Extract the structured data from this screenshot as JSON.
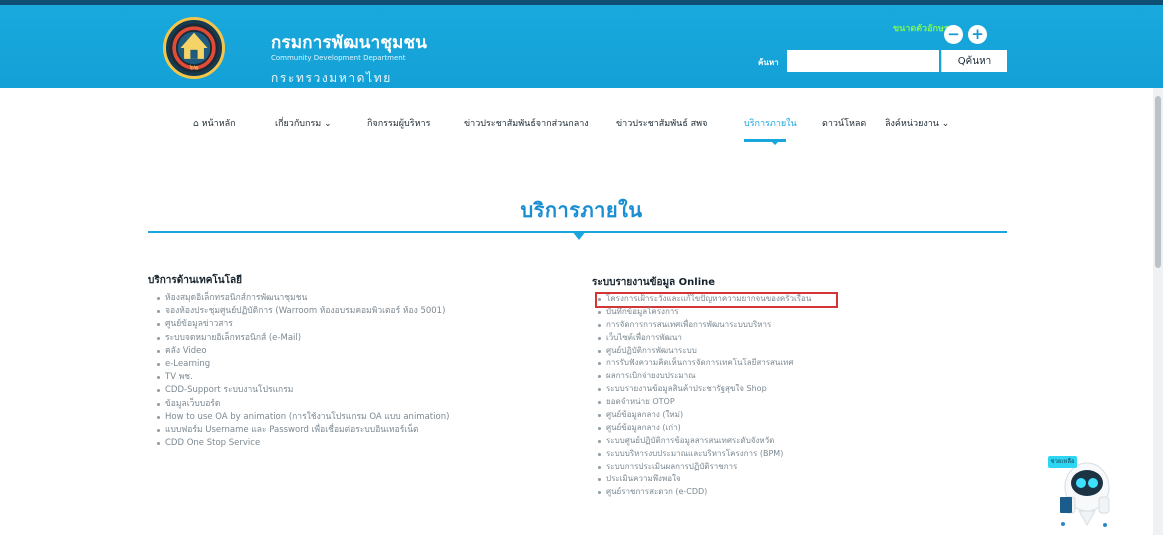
{
  "header": {
    "dept_name": "กรมการพัฒนาชุมชน",
    "dept_english": "Community Development Department",
    "ministry": "กระทรวงมหาดไทย",
    "logo_year": "๖๒",
    "font_size_label": "ขนาดตัวอักษร",
    "minus": "−",
    "plus": "+",
    "search_label": "ค้นหา",
    "search_placeholder": "",
    "search_button": "Qค้นหา",
    "brand_color": "#13a0d6"
  },
  "nav": {
    "items": [
      {
        "label": "หน้าหลัก",
        "icon": "home-icon"
      },
      {
        "label": "เกี่ยวกับกรม ⌄"
      },
      {
        "label": "กิจกรรมผู้บริหาร"
      },
      {
        "label": "ข่าวประชาสัมพันธ์จากส่วนกลาง"
      },
      {
        "label": "ข่าวประชาสัมพันธ์ สพจ"
      },
      {
        "label": "บริการภายใน",
        "active": true
      },
      {
        "label": "ดาวน์โหลด"
      },
      {
        "label": "ลิงค์หน่วยงาน ⌄"
      }
    ]
  },
  "page": {
    "title": "บริการภายใน"
  },
  "left_section": {
    "heading": "บริการด้านเทคโนโลยี",
    "items": [
      "ห้องสมุดอิเล็กทรอนิกส์การพัฒนาชุมชน",
      "จองห้องประชุมศูนย์ปฏิบัติการ (Warroom ห้องอบรมคอมพิวเตอร์ ห้อง 5001)",
      "ศูนย์ข้อมูลข่าวสาร",
      "ระบบจดหมายอิเล็กทรอนิกส์ (e-Mail)",
      "คลัง Video",
      "e-Learning",
      "TV พช.",
      "CDD-Support ระบบงานโปรแกรม",
      "ข้อมูลเว็บบอร์ด",
      "How to use OA by animation (การใช้งานโปรแกรม OA แบบ animation)",
      "แบบฟอร์ม Username และ Password เพื่อเชื่อมต่อระบบอินเทอร์เน็ต",
      "CDD One Stop Service"
    ]
  },
  "right_section": {
    "heading": "ระบบรายงานข้อมูล Online",
    "highlight_color": "#d53437",
    "items": [
      "โครงการเฝ้าระวังและแก้ไขปัญหาความยากจนของครัวเรือน",
      "บันทึกข้อมูลโครงการ",
      "การจัดการการสนเทศเพื่อการพัฒนาระบบบริหาร",
      "เว็บไซต์เพื่อการพัฒนา",
      "ศูนย์ปฏิบัติการพัฒนาระบบ",
      "การรับฟังความคิดเห็นการจัดการเทคโนโลยีสารสนเทศ",
      "ผลการเบิกจ่ายงบประมาณ",
      "ระบบรายงานข้อมูลสินค้าประชารัฐสุขใจ Shop",
      "ยอดจำหน่าย OTOP",
      "ศูนย์ข้อมูลกลาง (ใหม่)",
      "ศูนย์ข้อมูลกลาง (เก่า)",
      "ระบบศูนย์ปฏิบัติการข้อมูลสารสนเทศระดับจังหวัด",
      "ระบบบริหารงบประมาณและบริหารโครงการ (BPM)",
      "ระบบการประเมินผลการปฏิบัติราชการ",
      "ประเมินความพึงพอใจ",
      "ศูนย์ราชการสะดวก (e-CDD)"
    ]
  },
  "assistant": {
    "badge": "ช่วยเหลือ"
  }
}
